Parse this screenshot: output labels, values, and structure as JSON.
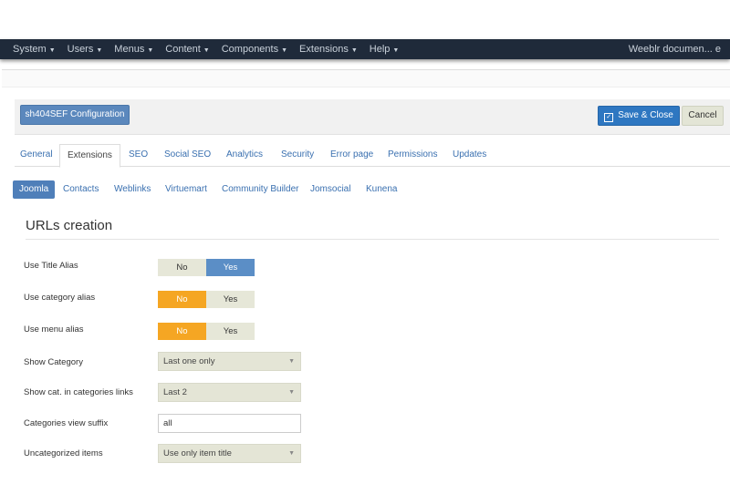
{
  "topbar": {
    "menu": [
      {
        "label": "System"
      },
      {
        "label": "Users"
      },
      {
        "label": "Menus"
      },
      {
        "label": "Content"
      },
      {
        "label": "Components"
      },
      {
        "label": "Extensions"
      },
      {
        "label": "Help"
      }
    ],
    "user": "Weeblr documen... e"
  },
  "toolbar": {
    "title_button": "sh404SEF Configuration",
    "save_close": "Save & Close",
    "cancel": "Cancel"
  },
  "tabs": [
    "General",
    "Extensions",
    "SEO",
    "Social SEO",
    "Analytics",
    "Security",
    "Error page",
    "Permissions",
    "Updates"
  ],
  "subtabs": [
    "Joomla",
    "Contacts",
    "Weblinks",
    "Virtuemart",
    "Community Builder",
    "Jomsocial",
    "Kunena"
  ],
  "section": {
    "title": "URLs creation"
  },
  "fields": {
    "use_title_alias": {
      "label": "Use Title Alias",
      "no": "No",
      "yes": "Yes",
      "value": "Yes"
    },
    "use_category_alias": {
      "label": "Use category alias",
      "no": "No",
      "yes": "Yes",
      "value": "No"
    },
    "use_menu_alias": {
      "label": "Use menu alias",
      "no": "No",
      "yes": "Yes",
      "value": "No"
    },
    "show_category": {
      "label": "Show Category",
      "value": "Last one only"
    },
    "show_cat_in_categories_links": {
      "label": "Show cat. in categories links",
      "value": "Last 2"
    },
    "categories_view_suffix": {
      "label": "Categories view suffix",
      "value": "all"
    },
    "uncategorized_items": {
      "label": "Uncategorized items",
      "value": "Use only item title"
    }
  },
  "colors": {
    "toggle_yes_active": "#5b8ec6",
    "toggle_no_active": "#f5a623",
    "save_button": "#2e77c1"
  },
  "icons": {
    "save": "checkbox-icon",
    "select_arrow": "caret-down-icon"
  }
}
